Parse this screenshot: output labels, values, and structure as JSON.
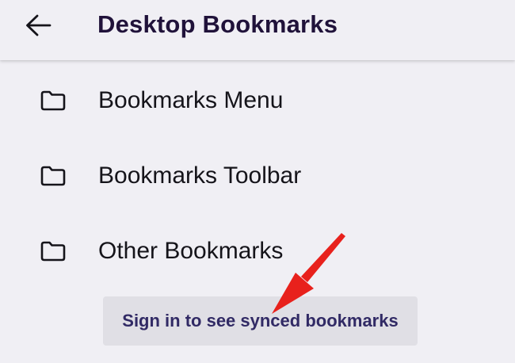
{
  "header": {
    "title": "Desktop Bookmarks",
    "back_icon": "arrow-left-icon"
  },
  "folders": [
    {
      "label": "Bookmarks Menu",
      "icon": "folder-icon"
    },
    {
      "label": "Bookmarks Toolbar",
      "icon": "folder-icon"
    },
    {
      "label": "Other Bookmarks",
      "icon": "folder-icon"
    }
  ],
  "sign_in": {
    "label": "Sign in to see synced bookmarks"
  },
  "annotation": {
    "icon": "red-pointer-arrow",
    "color": "#e8211c"
  },
  "colors": {
    "background": "#f0eff4",
    "title": "#20123a",
    "button_bg": "#e0dfe5",
    "button_text": "#312a65"
  }
}
